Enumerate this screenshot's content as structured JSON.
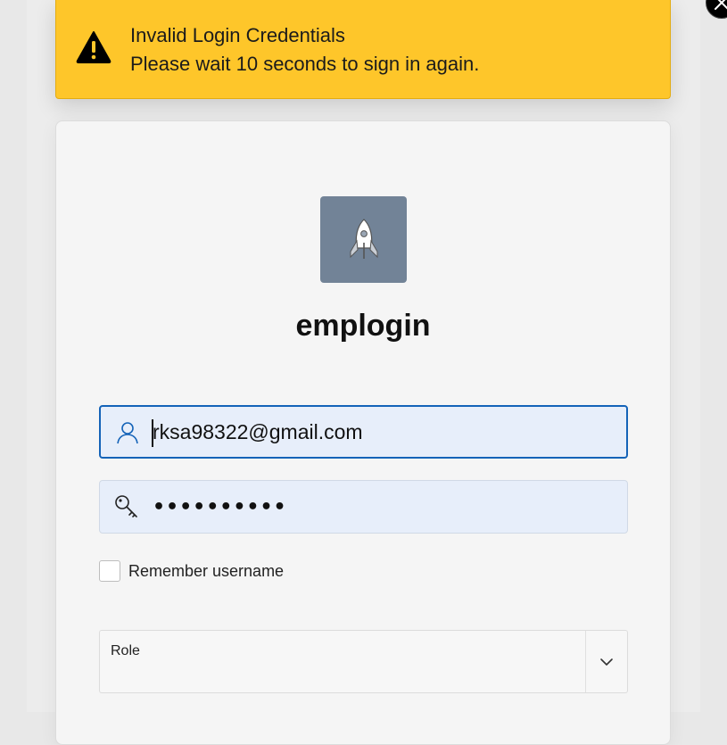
{
  "toast": {
    "type": "warning",
    "title": "Invalid Login Credentials",
    "message": "Please wait 10 seconds to sign in again.",
    "color": "#fec62a",
    "icon": "warning-icon",
    "close_icon": "close-icon"
  },
  "app": {
    "logo_icon": "rocket-icon",
    "logo_bg": "#728397",
    "title": "emplogin"
  },
  "form": {
    "username": {
      "value": "rksa98322@gmail.com",
      "icon": "user-icon"
    },
    "password": {
      "masked_value": "••••••••••",
      "icon": "key-icon"
    },
    "remember": {
      "label": "Remember username",
      "checked": false
    },
    "role": {
      "label": "Role",
      "selected": "",
      "icon": "chevron-down-icon"
    }
  },
  "colors": {
    "focus_border": "#1463b8",
    "field_bg": "#e7eefa"
  }
}
